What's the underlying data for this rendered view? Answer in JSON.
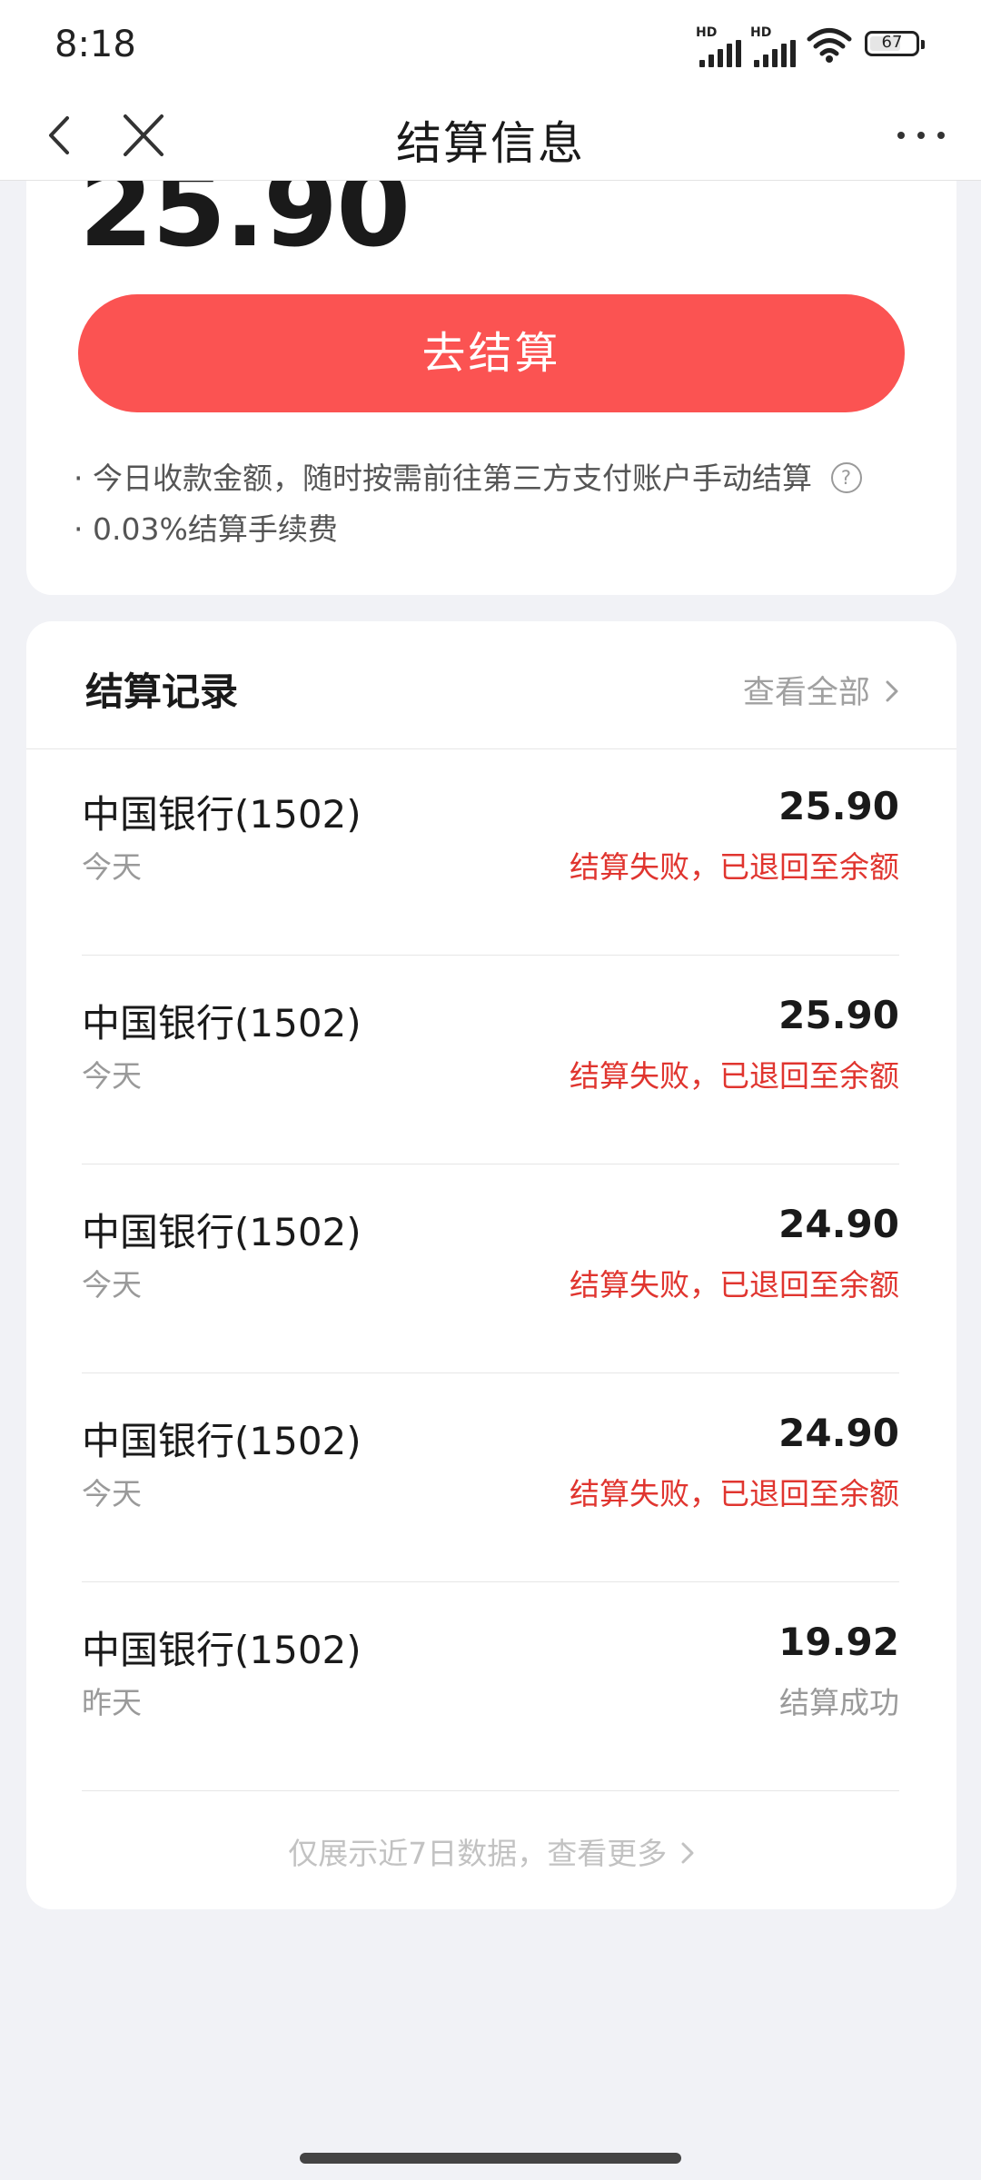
{
  "status_bar": {
    "time": "8:18",
    "sim1": "HD",
    "sim2": "HD",
    "battery": "67"
  },
  "nav": {
    "title": "结算信息"
  },
  "balance": {
    "amount": "25.90",
    "settle_label": "去结算",
    "note1": "今日收款金额，随时按需前往第三方支付账户手动结算",
    "note2": "0.03%结算手续费",
    "note_bullet": "·",
    "help_symbol": "?"
  },
  "records": {
    "title": "结算记录",
    "view_all": "查看全部",
    "items": [
      {
        "bank": "中国银行(1502)",
        "day": "今天",
        "amount": "25.90",
        "status": "结算失败，已退回至余额",
        "status_color": "#e0352f"
      },
      {
        "bank": "中国银行(1502)",
        "day": "今天",
        "amount": "25.90",
        "status": "结算失败，已退回至余额",
        "status_color": "#e0352f"
      },
      {
        "bank": "中国银行(1502)",
        "day": "今天",
        "amount": "24.90",
        "status": "结算失败，已退回至余额",
        "status_color": "#e0352f"
      },
      {
        "bank": "中国银行(1502)",
        "day": "今天",
        "amount": "24.90",
        "status": "结算失败，已退回至余额",
        "status_color": "#e0352f"
      },
      {
        "bank": "中国银行(1502)",
        "day": "昨天",
        "amount": "19.92",
        "status": "结算成功",
        "status_color": "#9a9a9a"
      }
    ],
    "footer": "仅展示近7日数据，查看更多"
  },
  "colors": {
    "accent": "#fb5352",
    "fail": "#e0352f",
    "background": "#f1f2f6"
  }
}
